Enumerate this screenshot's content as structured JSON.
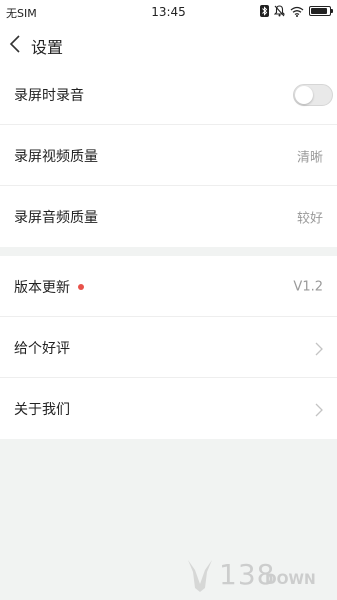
{
  "status_bar": {
    "carrier": "无SIM",
    "time": "13:45",
    "battery_level": 0.9
  },
  "nav": {
    "title": "设置",
    "back_icon": "chevron-left-icon"
  },
  "settings_group_1": [
    {
      "label": "录屏时录音",
      "type": "toggle",
      "on": false
    },
    {
      "label": "录屏视频质量",
      "value": "清晰"
    },
    {
      "label": "录屏音频质量",
      "value": "较好"
    }
  ],
  "settings_group_2": [
    {
      "label": "版本更新",
      "value": "V1.2",
      "badge": "red-dot"
    },
    {
      "label": "给个好评",
      "icon": "chevron-right-icon"
    },
    {
      "label": "关于我们",
      "icon": "chevron-right-icon"
    }
  ],
  "watermark": {
    "number": "138",
    "suffix": "DOWN"
  },
  "colors": {
    "background": "#f1f3f2",
    "card": "#ffffff",
    "badge": "#e8524a",
    "secondary_text": "#9a9a9a"
  }
}
